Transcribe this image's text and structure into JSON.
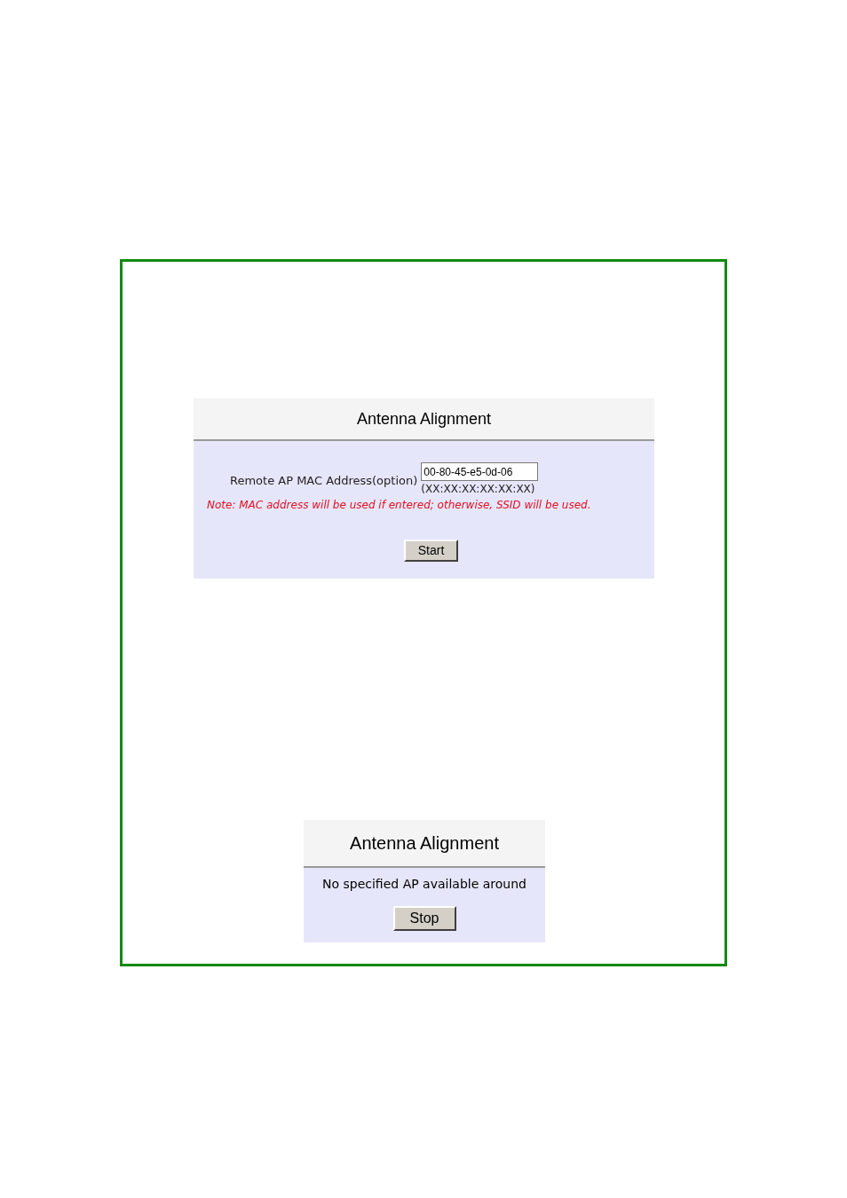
{
  "start_panel": {
    "title": "Antenna Alignment",
    "mac_label": "Remote AP MAC Address(option)",
    "mac_field": {
      "value": "00-80-45-e5-0d-06"
    },
    "format_hint": "(XX:XX:XX:XX:XX:XX)",
    "note": "Note: MAC address will be used if entered; otherwise, SSID will be used.",
    "button": "Start"
  },
  "stop_panel": {
    "title": "Antenna Alignment",
    "message": "No specified AP available around",
    "button": "Stop"
  }
}
